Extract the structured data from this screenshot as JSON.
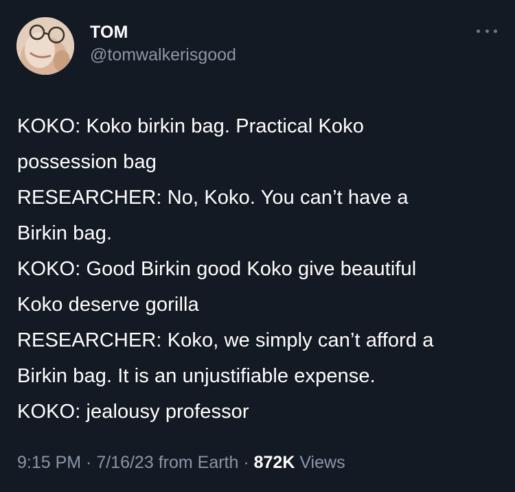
{
  "author": {
    "display_name": "TOM",
    "handle": "@tomwalkerisgood",
    "avatar_icon": "profile-photo"
  },
  "more_icon": "more-horizontal-icon",
  "tweet_lines": [
    "KOKO: Koko birkin bag. Practical Koko",
    "possession bag",
    "RESEARCHER: No, Koko. You can’t have a",
    "Birkin bag.",
    "KOKO: Good Birkin good Koko give beautiful",
    "Koko deserve gorilla",
    "RESEARCHER: Koko, we simply can’t afford a",
    "Birkin bag. It is an unjustifiable expense.",
    "KOKO: jealousy professor"
  ],
  "meta": {
    "time": "9:15 PM",
    "separator": " · ",
    "date": "7/16/23",
    "source": " from Earth",
    "views_count": "872K",
    "views_label": " Views"
  },
  "colors": {
    "background": "#141a24",
    "primary_text": "#ffffff",
    "secondary_text": "#8b97a6"
  }
}
